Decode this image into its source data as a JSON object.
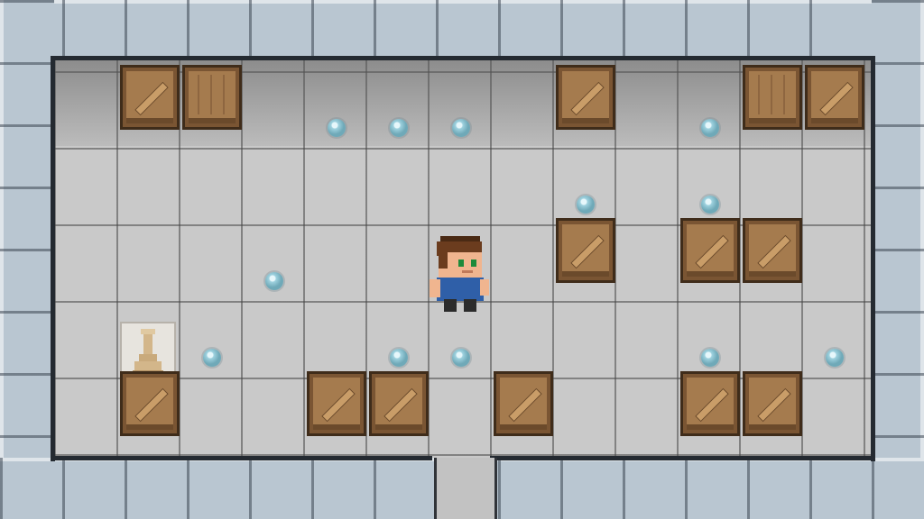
{
  "game": {
    "genre": "sokoban",
    "colors": {
      "wall": "#b9c6d1",
      "floor": "#c9c9c9",
      "crate": "#a57b4e",
      "goal": "#9fd2df",
      "player_shirt": "#2f5fa8",
      "player_hair": "#6b3c1e"
    }
  },
  "board": {
    "columns": 13,
    "rows": 6,
    "crates": [
      {
        "col": 1,
        "row": 0,
        "style": "diagonal"
      },
      {
        "col": 2,
        "row": 0,
        "style": "plank"
      },
      {
        "col": 8,
        "row": 0,
        "style": "diagonal"
      },
      {
        "col": 11,
        "row": 0,
        "style": "plank"
      },
      {
        "col": 12,
        "row": 0,
        "style": "diagonal"
      },
      {
        "col": 8,
        "row": 2,
        "style": "diagonal"
      },
      {
        "col": 10,
        "row": 2,
        "style": "diagonal"
      },
      {
        "col": 11,
        "row": 2,
        "style": "diagonal"
      },
      {
        "col": 1,
        "row": 4,
        "style": "diagonal"
      },
      {
        "col": 4,
        "row": 4,
        "style": "diagonal"
      },
      {
        "col": 5,
        "row": 4,
        "style": "diagonal"
      },
      {
        "col": 7,
        "row": 4,
        "style": "diagonal"
      },
      {
        "col": 10,
        "row": 4,
        "style": "diagonal"
      },
      {
        "col": 11,
        "row": 4,
        "style": "diagonal"
      }
    ],
    "goals": [
      {
        "col": 4,
        "row": 0
      },
      {
        "col": 5,
        "row": 0
      },
      {
        "col": 6,
        "row": 0
      },
      {
        "col": 10,
        "row": 0
      },
      {
        "col": 8,
        "row": 1
      },
      {
        "col": 10,
        "row": 1
      },
      {
        "col": 3,
        "row": 2
      },
      {
        "col": 2,
        "row": 3
      },
      {
        "col": 5,
        "row": 3
      },
      {
        "col": 6,
        "row": 3
      },
      {
        "col": 10,
        "row": 3
      },
      {
        "col": 12,
        "row": 3
      }
    ],
    "player": {
      "col": 6,
      "row": 2,
      "icon": "player-character-icon"
    },
    "pawn": {
      "col": 1,
      "row": 3,
      "icon": "pawn-statue-icon"
    },
    "exit": {
      "col": 6,
      "side": "bottom"
    }
  }
}
